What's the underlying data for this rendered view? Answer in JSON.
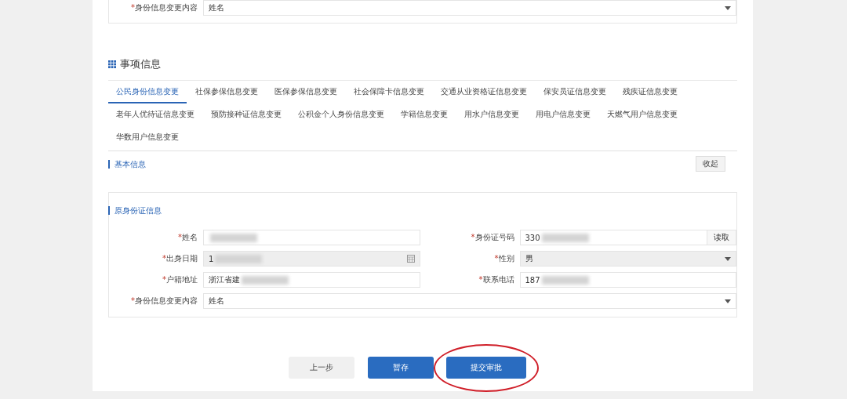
{
  "top_field": {
    "label": "身份信息变更内容",
    "required_mark": "*",
    "value": "姓名",
    "kind": "select",
    "disabled": false
  },
  "section_title": "事项信息",
  "tabs": [
    {
      "label": "公民身份信息变更",
      "selected": true
    },
    {
      "label": "社保参保信息变更",
      "selected": false
    },
    {
      "label": "医保参保信息变更",
      "selected": false
    },
    {
      "label": "社会保障卡信息变更",
      "selected": false
    },
    {
      "label": "交通从业资格证信息变更",
      "selected": false
    },
    {
      "label": "保安员证信息变更",
      "selected": false
    },
    {
      "label": "残疾证信息变更",
      "selected": false
    },
    {
      "label": "老年人优待证信息变更",
      "selected": false
    },
    {
      "label": "预防接种证信息变更",
      "selected": false
    },
    {
      "label": "公积金个人身份信息变更",
      "selected": false
    },
    {
      "label": "学籍信息变更",
      "selected": false
    },
    {
      "label": "用水户信息变更",
      "selected": false
    },
    {
      "label": "用电户信息变更",
      "selected": false
    },
    {
      "label": "天燃气用户信息变更",
      "selected": false
    },
    {
      "label": "华数用户信息变更",
      "selected": false
    }
  ],
  "basic_info": {
    "title": "基本信息",
    "collapse_button": "收起"
  },
  "panel": {
    "title": "原身份证信息",
    "fields": [
      {
        "label": "姓名",
        "required_mark": "*",
        "kind": "text",
        "disabled": false,
        "redacted": true
      },
      {
        "label": "身份证号码",
        "required_mark": "*",
        "value": "330",
        "kind": "text-button",
        "button": "读取",
        "disabled": false,
        "redacted": true
      },
      {
        "label": "出身日期",
        "required_mark": "*",
        "value": "1",
        "kind": "date",
        "disabled": true,
        "redacted": true
      },
      {
        "label": "性别",
        "required_mark": "*",
        "value": "男",
        "kind": "select",
        "disabled": true,
        "redacted": false
      },
      {
        "label": "户籍地址",
        "required_mark": "*",
        "value": "浙江省建",
        "kind": "text",
        "disabled": false,
        "redacted": true
      },
      {
        "label": "联系电话",
        "required_mark": "*",
        "value": "187",
        "kind": "text",
        "disabled": false,
        "redacted": true
      },
      {
        "label": "身份信息变更内容",
        "required_mark": "*",
        "value": "姓名",
        "kind": "select",
        "disabled": false,
        "redacted": false,
        "full_width": true
      }
    ]
  },
  "buttons": [
    {
      "label": "上一步",
      "kind": "secondary",
      "highlighted": false
    },
    {
      "label": "暂存",
      "kind": "primary",
      "highlighted": false
    },
    {
      "label": "提交审批",
      "kind": "primary",
      "highlighted": true
    }
  ]
}
